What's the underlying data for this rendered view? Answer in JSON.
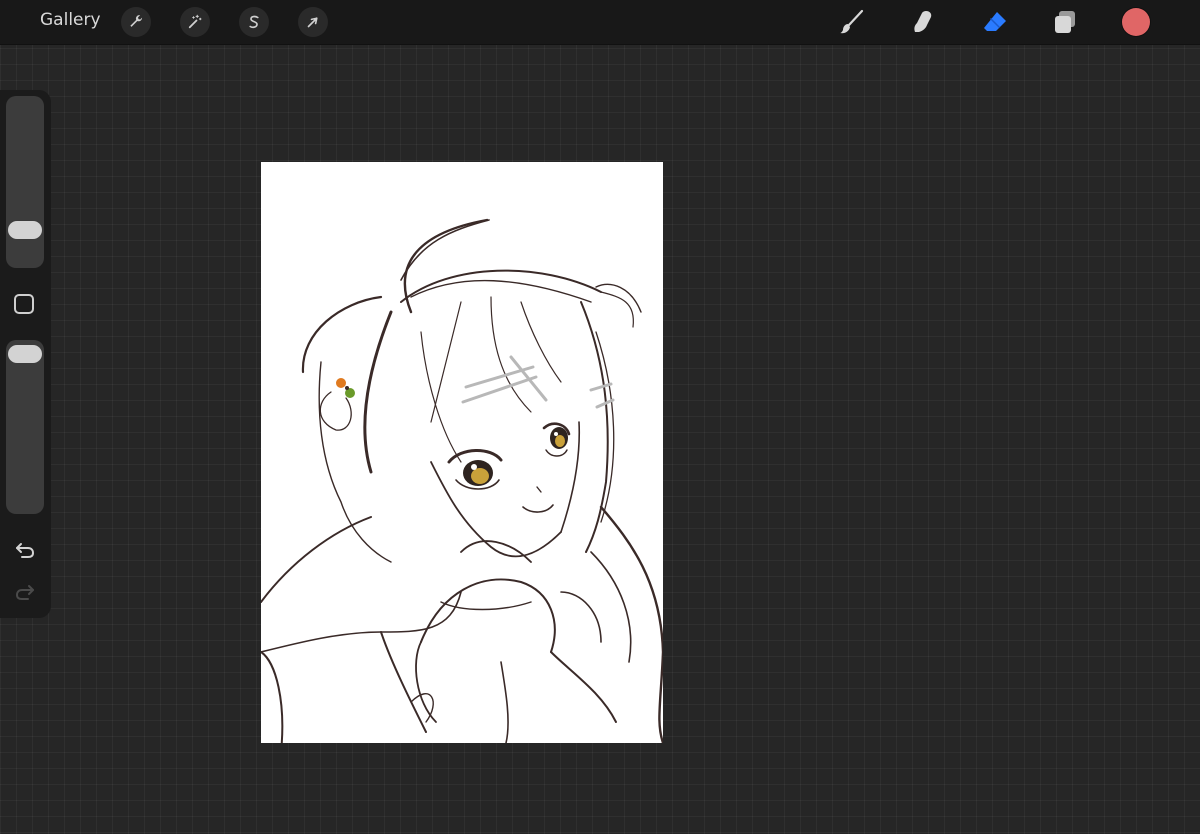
{
  "topbar": {
    "gallery_label": "Gallery",
    "left_tools": [
      {
        "name": "actions",
        "icon": "wrench-icon"
      },
      {
        "name": "adjustments",
        "icon": "magic-wand-icon"
      },
      {
        "name": "selection",
        "icon": "selection-s-icon"
      },
      {
        "name": "transform",
        "icon": "arrow-cursor-icon"
      }
    ],
    "right_tools": [
      {
        "name": "brush",
        "icon": "brush-icon",
        "active": false
      },
      {
        "name": "smudge",
        "icon": "smudge-finger-icon",
        "active": false
      },
      {
        "name": "eraser",
        "icon": "eraser-icon",
        "active": true
      },
      {
        "name": "layers",
        "icon": "layers-icon",
        "active": false
      }
    ],
    "current_color": "#e06666"
  },
  "sidebar": {
    "brush_size_level": 0.18,
    "opacity_level": 0.98,
    "icons": [
      "modify-square-icon",
      "undo-icon",
      "redo-icon"
    ]
  },
  "canvas": {
    "background": "#ffffff",
    "line_color": "#3a2a28",
    "accent_colors": {
      "eye_iris": "#c9a13a",
      "hairclip": "#b8b8b8",
      "bead_orange": "#e07a1f",
      "bead_green": "#6a9a2a"
    }
  },
  "theme": {
    "accent": "#2a7bff",
    "bar_bg": "#181818",
    "workspace_bg": "#262626"
  }
}
